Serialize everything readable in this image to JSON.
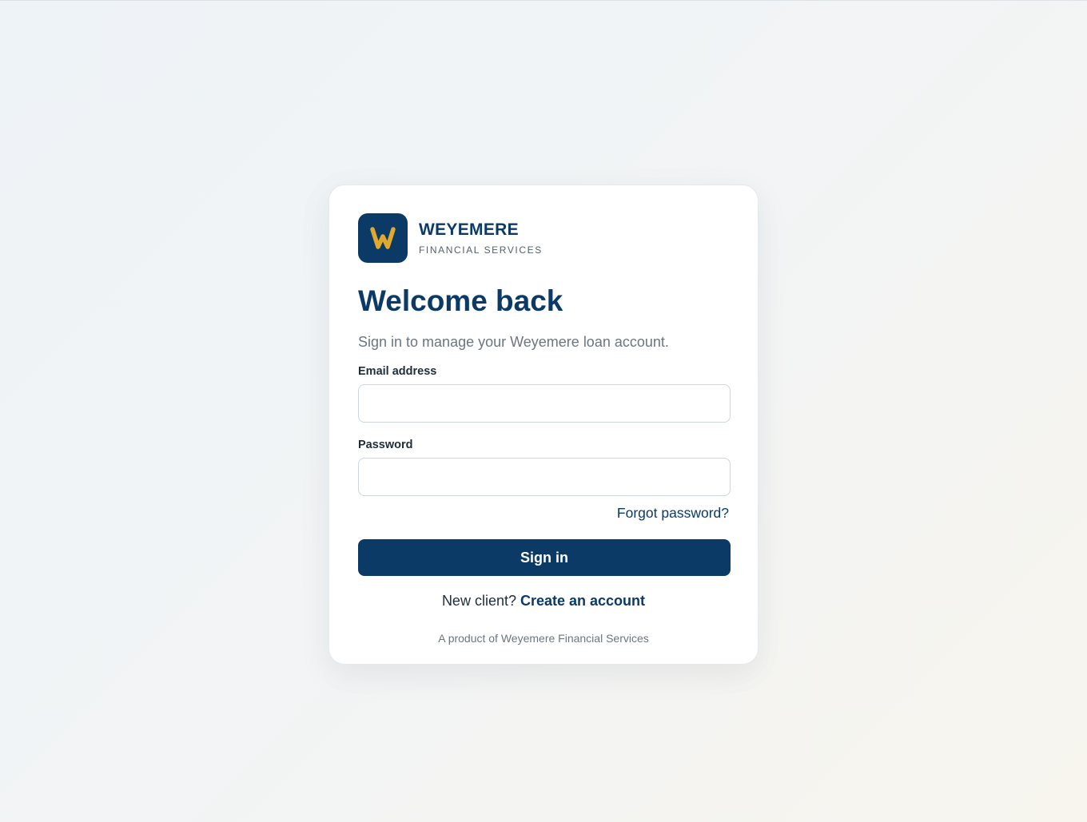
{
  "brand": {
    "logo_letter": "W",
    "name": "WEYEMERE",
    "tagline": "FINANCIAL SERVICES"
  },
  "heading": {
    "title": "Welcome back",
    "subtitle": "Sign in to manage your Weyemere loan account."
  },
  "form": {
    "email": {
      "label": "Email address",
      "value": "",
      "placeholder": ""
    },
    "password": {
      "label": "Password",
      "value": "",
      "placeholder": ""
    },
    "forgot_label": "Forgot password?",
    "submit_label": "Sign in"
  },
  "signup": {
    "prompt": "New client?",
    "link_label": "Create an account"
  },
  "footer": {
    "text": "A product of Weyemere Financial Services"
  },
  "colors": {
    "brand_navy": "#0b3a66",
    "logo_gold": "#e0a92e",
    "muted_text": "#6b7680",
    "card_background": "#ffffff"
  },
  "icons": {
    "logo": "weyemere-w-logo"
  }
}
